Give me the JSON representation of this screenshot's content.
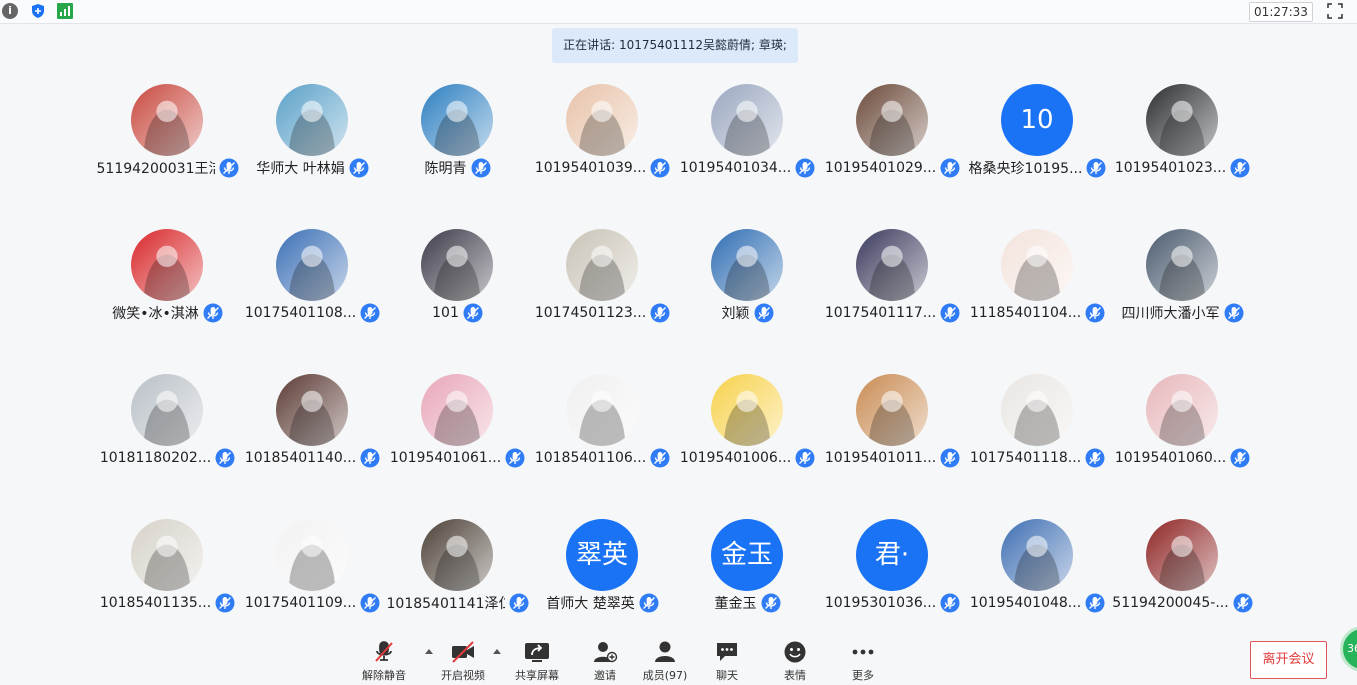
{
  "topbar": {
    "info_icon": "i",
    "timer": "01:27:33"
  },
  "speaking_banner": "正在讲话: 10175401112吴懿蔚倩; 章瑛;",
  "participants": [
    {
      "name": "51194200031王洁",
      "avatar": "photo",
      "color": "#c8493f"
    },
    {
      "name": "华师大 叶林娟",
      "avatar": "photo",
      "color": "#5aa0c8"
    },
    {
      "name": "陈明青",
      "avatar": "photo",
      "color": "#2d7fc1"
    },
    {
      "name": "10195401039...",
      "avatar": "photo",
      "color": "#e7c2a8"
    },
    {
      "name": "10195401034...",
      "avatar": "photo",
      "color": "#9aa7c0"
    },
    {
      "name": "10195401029...",
      "avatar": "photo",
      "color": "#6b4a3a"
    },
    {
      "name": "格桑央珍10195...",
      "avatar": "text",
      "text": "10",
      "color": "#1a73f5"
    },
    {
      "name": "10195401023...",
      "avatar": "photo",
      "color": "#2a2d30"
    },
    {
      "name": "微笑•冰•淇淋",
      "avatar": "photo",
      "color": "#d8272a"
    },
    {
      "name": "10175401108...",
      "avatar": "photo",
      "color": "#3b6fb5"
    },
    {
      "name": "101",
      "avatar": "photo",
      "color": "#3c3a48"
    },
    {
      "name": "10174501123...",
      "avatar": "photo",
      "color": "#c9c3b6"
    },
    {
      "name": "刘颖",
      "avatar": "photo",
      "color": "#2f6db3"
    },
    {
      "name": "10175401117...",
      "avatar": "photo",
      "color": "#3b3b5e"
    },
    {
      "name": "11185401104...",
      "avatar": "photo",
      "color": "#f3e3dc"
    },
    {
      "name": "四川师大潘小军",
      "avatar": "photo",
      "color": "#4a5a6e"
    },
    {
      "name": "10181180202...",
      "avatar": "photo",
      "color": "#b9c0c7"
    },
    {
      "name": "10185401140...",
      "avatar": "photo",
      "color": "#5b3a34"
    },
    {
      "name": "10195401061...",
      "avatar": "photo",
      "color": "#e8a6b9"
    },
    {
      "name": "10185401106...",
      "avatar": "photo",
      "color": "#f0f0f0"
    },
    {
      "name": "10195401006...",
      "avatar": "photo",
      "color": "#f7d14a"
    },
    {
      "name": "10195401011...",
      "avatar": "photo",
      "color": "#c98b52"
    },
    {
      "name": "10175401118...",
      "avatar": "photo",
      "color": "#e9e6e2"
    },
    {
      "name": "10195401060...",
      "avatar": "photo",
      "color": "#e7b7bb"
    },
    {
      "name": "10185401135...",
      "avatar": "photo",
      "color": "#d6d2c9"
    },
    {
      "name": "10175401109...",
      "avatar": "photo",
      "color": "#f2f2f2"
    },
    {
      "name": "10185401141泽仁...",
      "avatar": "photo",
      "color": "#4b4036"
    },
    {
      "name": "首师大 楚翠英",
      "avatar": "text",
      "text": "翠英",
      "color": "#1a73f5"
    },
    {
      "name": "董金玉",
      "avatar": "text",
      "text": "金玉",
      "color": "#1a73f5"
    },
    {
      "name": "10195301036...",
      "avatar": "text",
      "text": "君·",
      "color": "#1a73f5"
    },
    {
      "name": "10195401048...",
      "avatar": "photo",
      "color": "#3f6fb3"
    },
    {
      "name": "51194200045-...",
      "avatar": "photo",
      "color": "#8e2424"
    }
  ],
  "toolbar": {
    "unmute": "解除静音",
    "start_video": "开启视频",
    "share_screen": "共享屏幕",
    "invite": "邀请",
    "members": "成员(97)",
    "chat": "聊天",
    "reactions": "表情",
    "more": "更多",
    "leave": "离开会议"
  },
  "corner_badge": "36",
  "colors": {
    "accent": "#1a73f5",
    "mic_badge": "#2f7cf6",
    "leave_red": "#e03a3a"
  }
}
